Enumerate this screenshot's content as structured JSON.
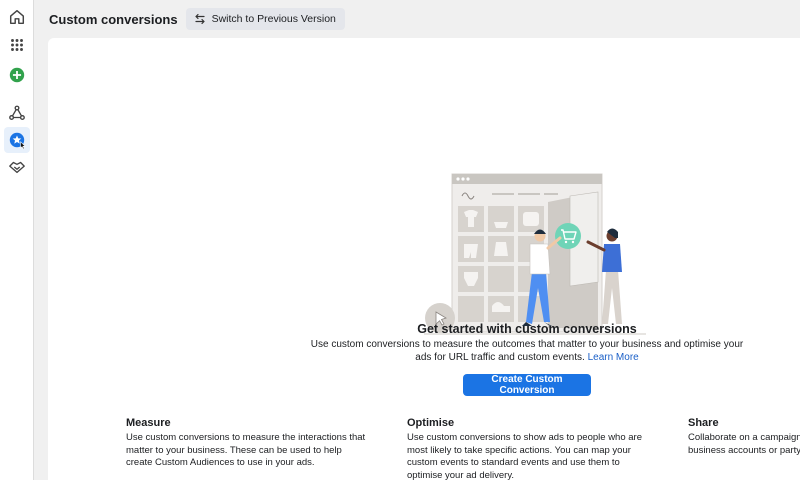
{
  "header": {
    "title": "Custom conversions",
    "switch_label": "Switch to Previous Version"
  },
  "rail": {
    "icons": [
      "home-icon",
      "apps-grid-icon",
      "create-plus-icon",
      "network-icon",
      "star-badge-icon",
      "handshake-icon"
    ],
    "active": "star-badge-icon"
  },
  "hero": {
    "title": "Get started with custom conversions",
    "description": "Use custom conversions to measure the outcomes that matter to your business and optimise your ads for URL traffic and custom events.",
    "learn_more": "Learn More",
    "cta": "Create Custom Conversion"
  },
  "features": [
    {
      "title": "Measure",
      "body": "Use custom conversions to measure the interactions that matter to your business. These can be used to help create Custom Audiences to use in your ads."
    },
    {
      "title": "Optimise",
      "body": "Use custom conversions to show ads to people who are most likely to take specific actions. You can map your custom events to standard events and use them to optimise your ad delivery."
    },
    {
      "title": "Share",
      "body": "Collaborate on a campaign by sharing with other ad or business accounts or party agencies."
    }
  ],
  "colors": {
    "primary": "#1b74e4",
    "link": "#1a5fc7",
    "rail_active": "#e7f0fb",
    "create_green": "#31a24c"
  }
}
